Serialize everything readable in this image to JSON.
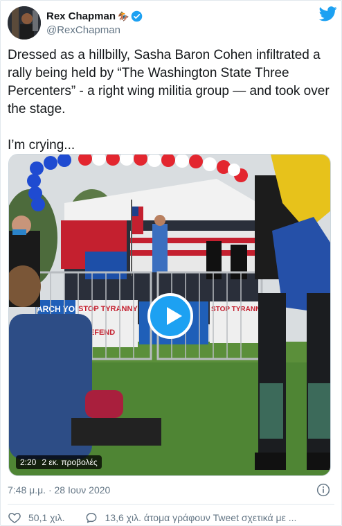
{
  "author": {
    "display_name": "Rex Chapman",
    "name_emoji": "🏇",
    "handle": "@RexChapman"
  },
  "tweet": {
    "text": "Dressed as a hillbilly, Sasha Baron Cohen infiltrated a rally being held by “The Washington State Three Percenters” - a right wing militia group — and took over the stage.\n\nI’m crying..."
  },
  "media": {
    "duration": "2:20",
    "views": "2 εκ. προβολές",
    "banner_texts": [
      "ARCH YOUR",
      "STOP TYRANNY",
      "DEFEND",
      "STOP TYRANN"
    ]
  },
  "meta": {
    "timestamp": "7:48 μ.μ. · 28 Ιουν 2020"
  },
  "actions": {
    "likes": "50,1 χιλ.",
    "conversation": "13,6 χιλ. άτομα γράφουν Tweet σχετικά με ..."
  },
  "colors": {
    "accent": "#1da1f2",
    "verified": "#1da1f2"
  }
}
